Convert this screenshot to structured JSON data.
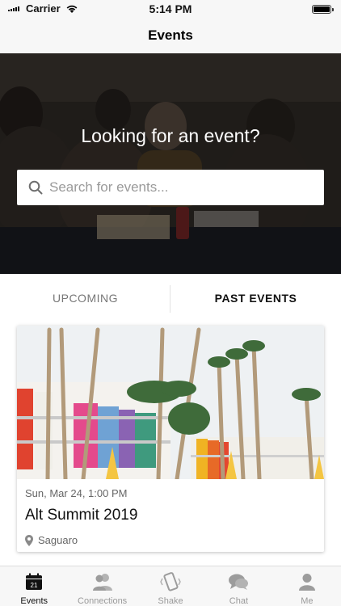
{
  "status_bar": {
    "carrier": "Carrier",
    "time": "5:14 PM",
    "battery_level": 1.0
  },
  "nav": {
    "title": "Events"
  },
  "hero": {
    "title": "Looking for an event?",
    "search_placeholder": "Search for events..."
  },
  "tabs": {
    "upcoming": "UPCOMING",
    "past": "PAST EVENTS",
    "selected": "past"
  },
  "event": {
    "date": "Sun, Mar 24, 1:00 PM",
    "title": "Alt Summit 2019",
    "location": "Saguaro"
  },
  "tab_bar": {
    "items": [
      {
        "label": "Events",
        "icon": "calendar-icon",
        "badge": "21",
        "active": true
      },
      {
        "label": "Connections",
        "icon": "people-icon",
        "active": false
      },
      {
        "label": "Shake",
        "icon": "phone-shake-icon",
        "active": false
      },
      {
        "label": "Chat",
        "icon": "chat-bubbles-icon",
        "active": false
      },
      {
        "label": "Me",
        "icon": "person-icon",
        "active": false
      }
    ]
  },
  "colors": {
    "accent": "#111111",
    "inactive": "#9a9a9a"
  }
}
